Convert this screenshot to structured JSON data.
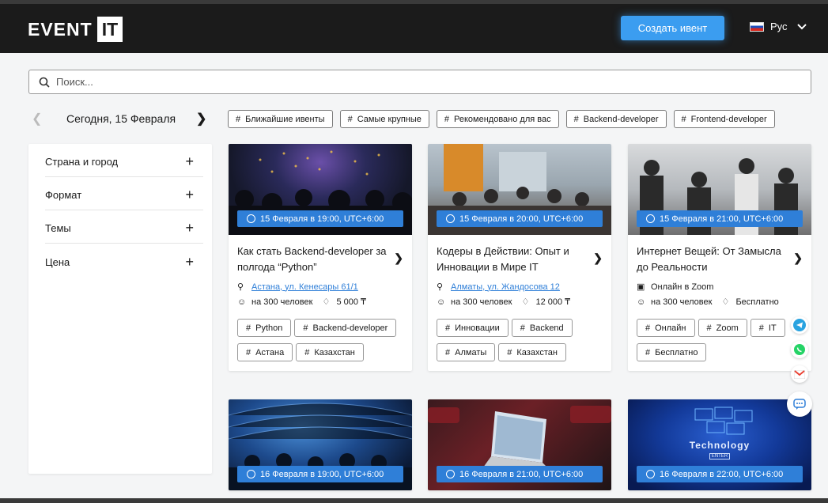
{
  "header": {
    "logo_left": "EVENT",
    "logo_right": "IT",
    "create_button": "Создать ивент",
    "language": "Рус"
  },
  "search": {
    "placeholder": "Поиск..."
  },
  "date_nav": {
    "label": "Сегодня, 15 Февраля"
  },
  "chips": [
    "Ближайшие ивенты",
    "Самые крупные",
    "Рекомендовано для вас",
    "Backend-developer",
    "Frontend-developer"
  ],
  "filters": [
    "Страна и город",
    "Формат",
    "Темы",
    "Цена"
  ],
  "cards": [
    {
      "date": "15 Февраля в 19:00, UTC+6:00",
      "title": "Как стать Backend-developer за полгода “Python”",
      "location": "Астана, ул. Кенесары 61/1",
      "location_link": true,
      "attendees": "на 300 человек",
      "price": "5 000 ₸",
      "tags": [
        "Python",
        "Backend-developer",
        "Астана",
        "Казахстан"
      ]
    },
    {
      "date": "15 Февраля в 20:00, UTC+6:00",
      "title": "Кодеры в Действии: Опыт и Инновации в Мире IT",
      "location": "Алматы, ул. Жандосова 12",
      "location_link": true,
      "attendees": "на 300 человек",
      "price": "12 000 ₸",
      "tags": [
        "Инновации",
        "Backend",
        "Алматы",
        "Казахстан"
      ]
    },
    {
      "date": "15 Февраля в 21:00, UTC+6:00",
      "title": "Интернет Вещей: От Замысла до Реальности",
      "location": "Онлайн в Zoom",
      "location_link": false,
      "attendees": "на 300 человек",
      "price": "Бесплатно",
      "tags": [
        "Онлайн",
        "Zoom",
        "IT",
        "Бесплатно"
      ]
    },
    {
      "date": "16 Февраля в 19:00, UTC+6:00"
    },
    {
      "date": "16 Февраля в 21:00, UTC+6:00"
    },
    {
      "date": "16 Февраля в 22:00, UTC+6:00",
      "image_text": "Technology",
      "image_subtext": "ENTER"
    }
  ],
  "colors": {
    "accent": "#2f7fd8",
    "button": "#3b9df0",
    "header_bg": "#1b1b1b",
    "telegram": "#2aa3e0",
    "whatsapp": "#25d366",
    "gmail": "#ea4335"
  },
  "floating_icons": [
    "telegram-icon",
    "whatsapp-icon",
    "gmail-icon",
    "chat-icon"
  ]
}
